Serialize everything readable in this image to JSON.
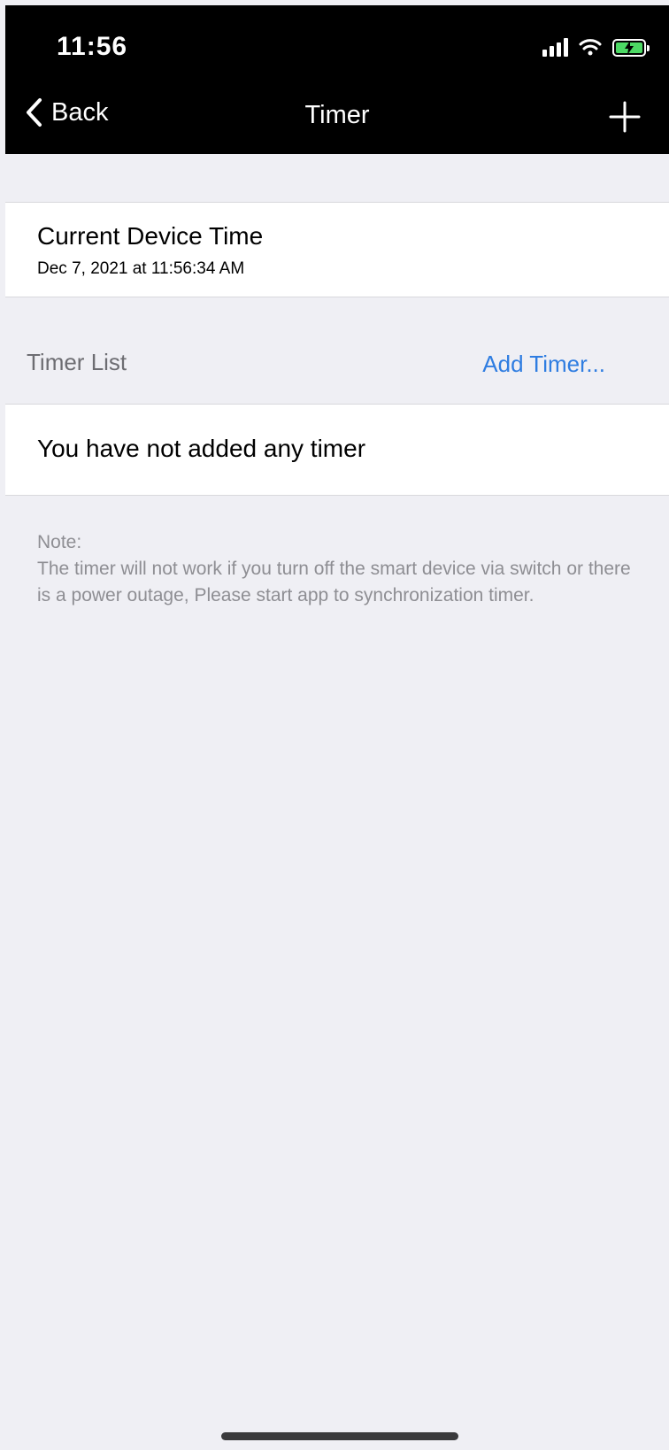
{
  "status_bar": {
    "time": "11:56"
  },
  "nav": {
    "back_label": "Back",
    "title": "Timer"
  },
  "device_time": {
    "title": "Current Device Time",
    "value": "Dec 7, 2021 at 11:56:34 AM"
  },
  "timer_list": {
    "label": "Timer List",
    "add_link": "Add Timer...",
    "empty_message": "You have not added any timer"
  },
  "note": {
    "heading": "Note:",
    "body": "The timer will not work if you turn off the smart device via switch or there is a power outage, Please start app to synchronization timer."
  },
  "colors": {
    "nav_background": "#000000",
    "accent_link": "#2f7de1",
    "page_background": "#efeff4",
    "battery_fill": "#4cd964"
  },
  "icons": [
    "chevron-left-icon",
    "plus-icon",
    "signal-icon",
    "wifi-icon",
    "battery-charging-icon"
  ]
}
